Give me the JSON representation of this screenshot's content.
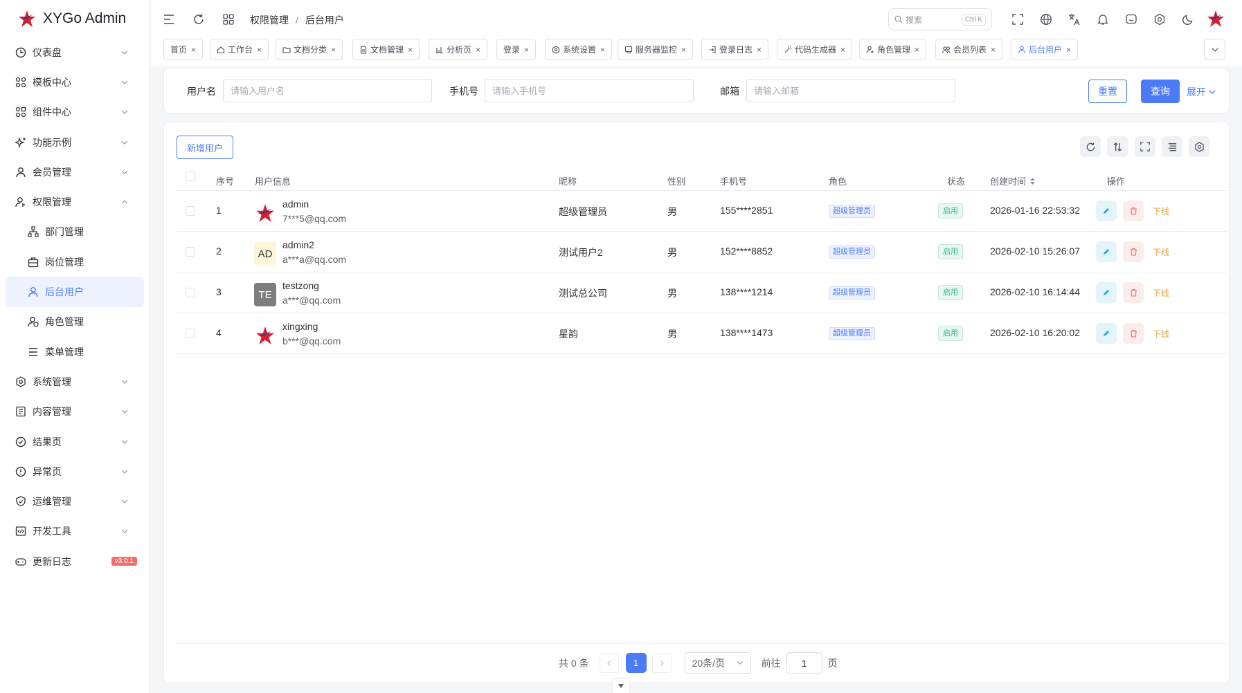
{
  "app": {
    "title": "XYGo Admin"
  },
  "sidebar": {
    "items": [
      {
        "label": "仪表盘",
        "icon": "clock-icon"
      },
      {
        "label": "模板中心",
        "icon": "grid-icon"
      },
      {
        "label": "组件中心",
        "icon": "apps-icon"
      },
      {
        "label": "功能示例",
        "icon": "sparkle-icon"
      },
      {
        "label": "会员管理",
        "icon": "user-icon"
      },
      {
        "label": "权限管理",
        "icon": "user-key-icon"
      },
      {
        "label": "部门管理",
        "icon": "org-icon"
      },
      {
        "label": "岗位管理",
        "icon": "briefcase-icon"
      },
      {
        "label": "后台用户",
        "icon": "user-icon"
      },
      {
        "label": "角色管理",
        "icon": "user-shield-icon"
      },
      {
        "label": "菜单管理",
        "icon": "menu-icon"
      },
      {
        "label": "系统管理",
        "icon": "gear-icon"
      },
      {
        "label": "内容管理",
        "icon": "document-icon"
      },
      {
        "label": "结果页",
        "icon": "check-circle-icon"
      },
      {
        "label": "异常页",
        "icon": "alert-circle-icon"
      },
      {
        "label": "运维管理",
        "icon": "shield-check-icon"
      },
      {
        "label": "开发工具",
        "icon": "code-icon"
      },
      {
        "label": "更新日志",
        "icon": "gamepad-icon"
      }
    ],
    "version_badge": "v3.0.1"
  },
  "header": {
    "breadcrumb": [
      "权限管理",
      "后台用户"
    ],
    "breadcrumb_sep": "/",
    "search_placeholder": "搜索",
    "search_shortcut": "Ctrl K"
  },
  "tabs": [
    {
      "label": "首页"
    },
    {
      "label": "工作台"
    },
    {
      "label": "文档分类"
    },
    {
      "label": "文档管理"
    },
    {
      "label": "分析页"
    },
    {
      "label": "登录"
    },
    {
      "label": "系统设置"
    },
    {
      "label": "服务器监控"
    },
    {
      "label": "登录日志"
    },
    {
      "label": "代码生成器"
    },
    {
      "label": "角色管理"
    },
    {
      "label": "会员列表"
    },
    {
      "label": "后台用户"
    }
  ],
  "filters": {
    "username_label": "用户名",
    "username_placeholder": "请输入用户名",
    "phone_label": "手机号",
    "phone_placeholder": "请输入手机号",
    "email_label": "邮箱",
    "email_placeholder": "请输入邮箱",
    "reset_label": "重置",
    "query_label": "查询",
    "expand_label": "展开"
  },
  "table": {
    "add_label": "新增用户",
    "columns": [
      "序号",
      "用户信息",
      "昵称",
      "性别",
      "手机号",
      "角色",
      "状态",
      "创建时间",
      "操作"
    ],
    "rows": [
      {
        "index": "1",
        "avatar": "",
        "name": "admin",
        "email": "7***5@qq.com",
        "nickname": "超级管理员",
        "gender": "男",
        "phone": "155****2851",
        "role": "超级管理员",
        "status": "启用",
        "created": "2026-01-16 22:53:32",
        "offline": "下线"
      },
      {
        "index": "2",
        "avatar": "AD",
        "name": "admin2",
        "email": "a***a@qq.com",
        "nickname": "测试用户2",
        "gender": "男",
        "phone": "152****8852",
        "role": "超级管理员",
        "status": "启用",
        "created": "2026-02-10 15:26:07",
        "offline": "下线"
      },
      {
        "index": "3",
        "avatar": "TE",
        "name": "testzong",
        "email": "a***@qq.com",
        "nickname": "测试总公司",
        "gender": "男",
        "phone": "138****1214",
        "role": "超级管理员",
        "status": "启用",
        "created": "2026-02-10 16:14:44",
        "offline": "下线"
      },
      {
        "index": "4",
        "avatar": "",
        "name": "xingxing",
        "email": "b***@qq.com",
        "nickname": "星韵",
        "gender": "男",
        "phone": "138****1473",
        "role": "超级管理员",
        "status": "启用",
        "created": "2026-02-10 16:20:02",
        "offline": "下线"
      }
    ]
  },
  "pagination": {
    "total": "共 0 条",
    "current": "1",
    "page_size": "20条/页",
    "goto_label": "前往",
    "goto_value": "1",
    "page_suffix": "页"
  },
  "colors": {
    "primary": "#4b7bf7",
    "success": "#2fb784",
    "danger": "#f56c6c",
    "warning": "#e6a23c"
  }
}
